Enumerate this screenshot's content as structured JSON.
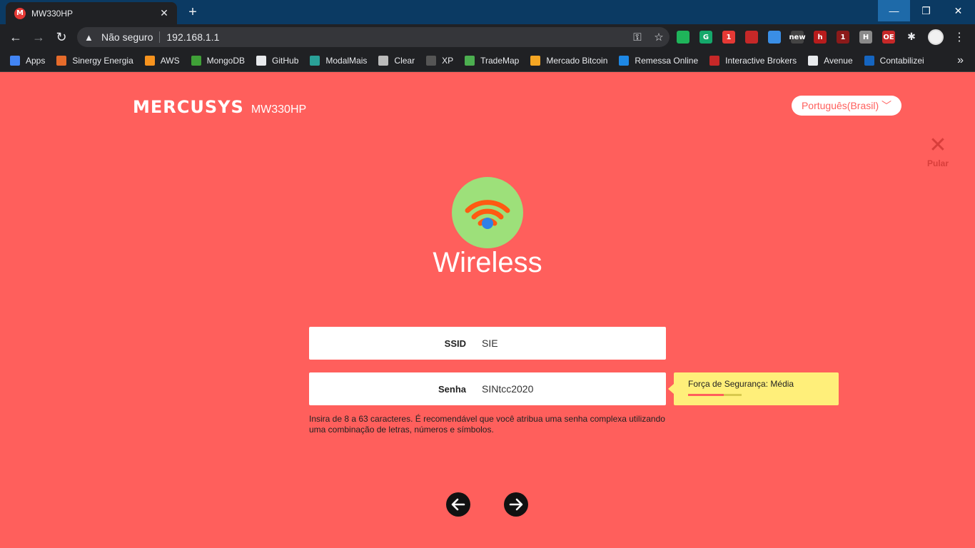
{
  "browser": {
    "tab": {
      "title": "MW330HP",
      "favicon_letter": "M"
    },
    "omnibox": {
      "security_label": "Não seguro",
      "url": "192.168.1.1"
    },
    "extensions": [
      {
        "name": "evernote-icon",
        "letter": "",
        "color": "#1fb45a"
      },
      {
        "name": "grammarly-icon",
        "letter": "G",
        "color": "#15a86b"
      },
      {
        "name": "extension-badge-icon",
        "letter": "1",
        "color": "#e53935"
      },
      {
        "name": "pdf-icon",
        "letter": "",
        "color": "#c62828"
      },
      {
        "name": "cloud-icon",
        "letter": "",
        "color": "#3a8ee6"
      },
      {
        "name": "new-tab-icon",
        "letter": "new",
        "color": "#444"
      },
      {
        "name": "h-extension-icon",
        "letter": "h",
        "color": "#b71c1c"
      },
      {
        "name": "ublock-icon",
        "letter": "1",
        "color": "#8b1a1a"
      },
      {
        "name": "h-gray-icon",
        "letter": "H",
        "color": "#8a8a8a"
      },
      {
        "name": "oe-icon",
        "letter": "OE",
        "color": "#c62828"
      }
    ],
    "bookmarks": [
      {
        "label": "Apps",
        "color": "#4285f4"
      },
      {
        "label": "Sinergy Energia",
        "color": "#e66b2b"
      },
      {
        "label": "AWS",
        "color": "#f7931e"
      },
      {
        "label": "MongoDB",
        "color": "#3fa037"
      },
      {
        "label": "GitHub",
        "color": "#e8eaed"
      },
      {
        "label": "ModalMais",
        "color": "#2aa198"
      },
      {
        "label": "Clear",
        "color": "#bbbbbb"
      },
      {
        "label": "XP",
        "color": "#555555"
      },
      {
        "label": "TradeMap",
        "color": "#4caf50"
      },
      {
        "label": "Mercado Bitcoin",
        "color": "#f5a623"
      },
      {
        "label": "Remessa Online",
        "color": "#1e88e5"
      },
      {
        "label": "Interactive Brokers",
        "color": "#c62828"
      },
      {
        "label": "Avenue",
        "color": "#e8eaed"
      },
      {
        "label": "Contabilizei",
        "color": "#1565c0"
      }
    ]
  },
  "page": {
    "brand": "MERCUSYS",
    "model": "MW330HP",
    "language": "Português(Brasil) ﹀",
    "skip_label": "Pular",
    "title": "Wireless",
    "ssid": {
      "label": "SSID",
      "value": "SIE"
    },
    "password": {
      "label": "Senha",
      "value": "SINtcc2020"
    },
    "hint": "Insira de 8 a 63 caracteres. É recomendável que você atribua uma senha complexa utilizando uma combinação de letras, números e símbolos.",
    "strength": {
      "label": "Força de Segurança: Média",
      "level": 0.67
    },
    "colors": {
      "background": "#ff5f5c",
      "wifi_circle": "#9de07a",
      "wifi_arcs": "#ff5a12",
      "wifi_dot": "#2f80e8",
      "tooltip": "#ffef7a"
    }
  }
}
